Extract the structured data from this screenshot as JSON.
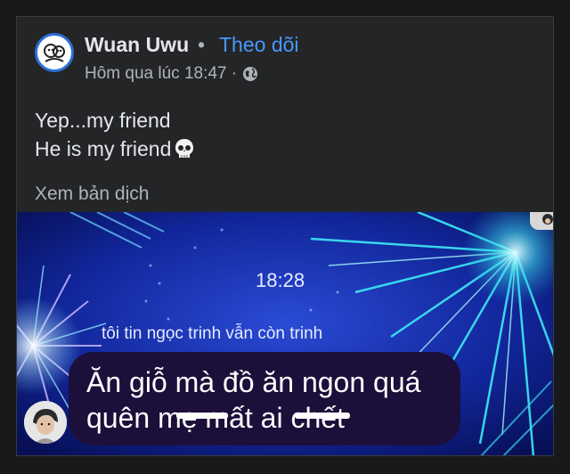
{
  "post": {
    "author": "Wuan Uwu",
    "separator": "•",
    "follow_label": "Theo dõi",
    "timestamp": "Hôm qua lúc 18:47 ·",
    "lines": [
      "Yep...my friend",
      "He is my friend"
    ],
    "see_translation": "Xem bản dịch"
  },
  "photo": {
    "time": "18:28",
    "caption": "tôi tin ngọc trinh vẫn còn trinh",
    "bubble_lines": [
      "Ăn giỗ mà đồ ăn ngon quá",
      "quên mẹ mất ai chết"
    ]
  },
  "icons": {
    "avatar": "cartoon-avatar-icon",
    "audience": "globe-icon",
    "emoji": "skull-emoji-icon"
  },
  "colors": {
    "background": "#18191a",
    "card": "#242526",
    "text": "#e4e6eb",
    "secondary": "#b0b3b8",
    "link": "#4599ff",
    "bubble": "#1c0f3a"
  }
}
